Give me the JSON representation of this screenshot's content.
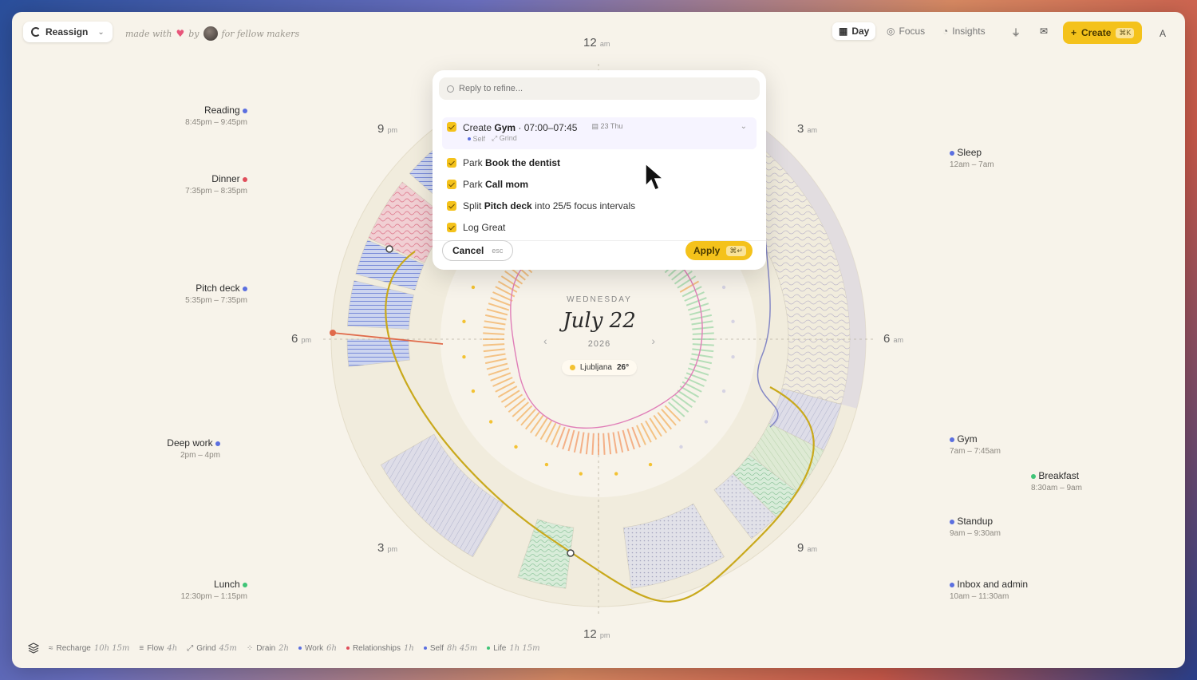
{
  "topbar": {
    "reassign": "Reassign",
    "made_with": "made with",
    "by": "by",
    "for_makers": "for fellow makers",
    "day": "Day",
    "focus": "Focus",
    "insights": "Insights",
    "create": "Create",
    "create_kbd": "⌘K",
    "avatar_letter": "A"
  },
  "hours": {
    "h12am": "12",
    "h12am_s": "am",
    "h3am": "3",
    "h3am_s": "am",
    "h6am": "6",
    "h6am_s": "am",
    "h9am": "9",
    "h9am_s": "am",
    "h12pm": "12",
    "h12pm_s": "pm",
    "h3pm": "3",
    "h3pm_s": "pm",
    "h6pm": "6",
    "h6pm_s": "pm",
    "h9pm": "9",
    "h9pm_s": "pm"
  },
  "center": {
    "weekday": "WEDNESDAY",
    "date": "July 22",
    "year": "2026",
    "city": "Ljubljana",
    "temp": "26°"
  },
  "events_left": [
    {
      "name": "Reading",
      "time": "8:45pm – 9:45pm"
    },
    {
      "name": "Dinner",
      "time": "7:35pm – 8:35pm"
    },
    {
      "name": "Pitch deck",
      "time": "5:35pm – 7:35pm"
    },
    {
      "name": "Deep work",
      "time": "2pm – 4pm"
    },
    {
      "name": "Lunch",
      "time": "12:30pm – 1:15pm"
    }
  ],
  "events_right": [
    {
      "name": "Sleep",
      "time": "12am – 7am"
    },
    {
      "name": "Gym",
      "time": "7am – 7:45am"
    },
    {
      "name": "Breakfast",
      "time": "8:30am – 9am"
    },
    {
      "name": "Standup",
      "time": "9am – 9:30am"
    },
    {
      "name": "Inbox and admin",
      "time": "10am – 11:30am"
    }
  ],
  "popup": {
    "search_placeholder": "Reply to refine...",
    "task1_verb": "Create",
    "task1_obj": "Gym",
    "task1_time": "· 07:00–07:45",
    "task1_date": "23 Thu",
    "task1_tag1": "Self",
    "task1_tag2": "Grind",
    "task2_verb": "Park",
    "task2_obj": "Book the dentist",
    "task3_verb": "Park",
    "task3_obj": "Call mom",
    "task4_verb": "Split",
    "task4_obj": "Pitch deck",
    "task4_rest": "into 25/5 focus intervals",
    "task5_verb": "Log",
    "task5_obj": "Great",
    "cancel": "Cancel",
    "cancel_kbd": "esc",
    "apply": "Apply",
    "apply_kbd": "⌘↵"
  },
  "legend": {
    "recharge": "Recharge",
    "recharge_v": "10h 15m",
    "flow": "Flow",
    "flow_v": "4h",
    "grind": "Grind",
    "grind_v": "45m",
    "drain": "Drain",
    "drain_v": "2h",
    "work": "Work",
    "work_v": "6h",
    "relationships": "Relationships",
    "relationships_v": "1h",
    "self": "Self",
    "self_v": "8h 45m",
    "life": "Life",
    "life_v": "1h 15m"
  },
  "colors": {
    "accent": "#f4c21b",
    "blue": "#5b6fe0",
    "red": "#e04d5a",
    "green": "#3fc477"
  }
}
